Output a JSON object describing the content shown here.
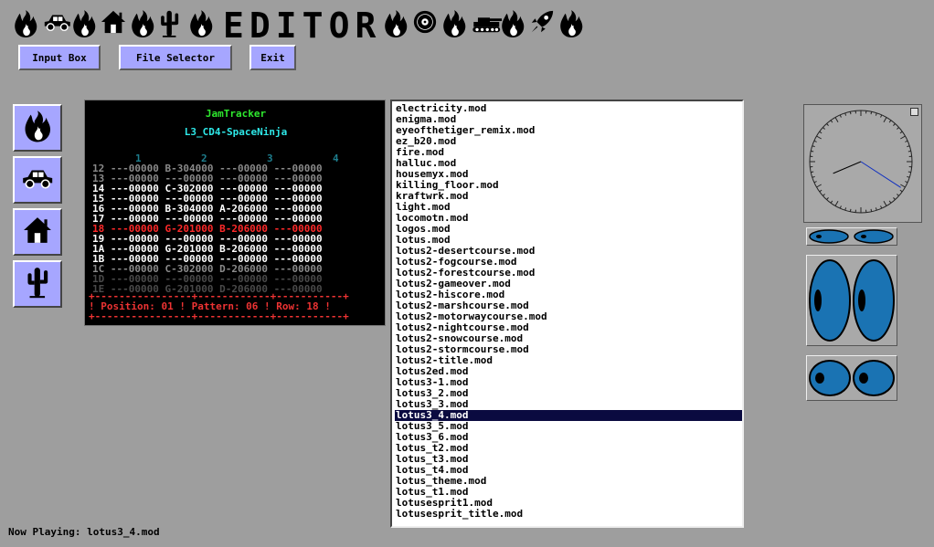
{
  "title": {
    "letters": [
      "E",
      "D",
      "I",
      "T",
      "O",
      "R"
    ]
  },
  "title_icons": {
    "left": [
      "fire-icon",
      "car-icon",
      "fire-icon",
      "house-icon",
      "fire-icon",
      "cactus-icon",
      "fire-icon"
    ],
    "right": [
      "fire-icon",
      "vinyl-record-icon",
      "fire-icon",
      "tank-icon",
      "fire-icon",
      "rocket-icon",
      "fire-icon"
    ]
  },
  "toolbar": {
    "input_box": "Input Box",
    "file_selector": "File Selector",
    "exit": "Exit"
  },
  "side_buttons": [
    "fire-icon",
    "car-icon",
    "house-icon",
    "cactus-icon"
  ],
  "tracker": {
    "app_name": "JamTracker",
    "song_name": "L3_CD4-SpaceNinja",
    "columns": [
      "1",
      "2",
      "3",
      "4"
    ],
    "rows": [
      {
        "text": "12 ---00000 B-304000 ---00000 ---00000",
        "style": "dim"
      },
      {
        "text": "13 ---00000 ---00000 ---00000 ---00000",
        "style": "dim"
      },
      {
        "text": "14 ---00000 C-302000 ---00000 ---00000",
        "style": "normal"
      },
      {
        "text": "15 ---00000 ---00000 ---00000 ---00000",
        "style": "normal"
      },
      {
        "text": "16 ---00000 B-304000 A-206000 ---00000",
        "style": "normal"
      },
      {
        "text": "17 ---00000 ---00000 ---00000 ---00000",
        "style": "normal"
      },
      {
        "text": "18 ---00000 G-201000 B-206000 ---00000",
        "style": "current"
      },
      {
        "text": "19 ---00000 ---00000 ---00000 ---00000",
        "style": "normal"
      },
      {
        "text": "1A ---00000 G-201000 B-206000 ---00000",
        "style": "normal"
      },
      {
        "text": "1B ---00000 ---00000 ---00000 ---00000",
        "style": "normal"
      },
      {
        "text": "1C ---00000 C-302000 D-206000 ---00000",
        "style": "dim"
      },
      {
        "text": "1D ---00000 ---00000 ---00000 ---00000",
        "style": "dimmer"
      },
      {
        "text": "1E ---00000 G-201000 D-206000 ---00000",
        "style": "dimmer"
      }
    ],
    "status_top": "+----------------+------------+-----------+",
    "status": "! Position: 01 ! Pattern: 06 ! Row: 18 !",
    "status_bottom": "+----------------+------------+-----------+",
    "colors": {
      "app_name": "#2ee82e",
      "song_name": "#2ee8e8",
      "current": "#ff2a2a",
      "normal": "#ffffff",
      "dim": "#8a8a8a",
      "dimmer": "#4a4a4a"
    }
  },
  "files": [
    "electricity.mod",
    "enigma.mod",
    "eyeofthetiger_remix.mod",
    "ez_b20.mod",
    "fire.mod",
    "halluc.mod",
    "housemyx.mod",
    "killing_floor.mod",
    "kraftwrk.mod",
    "light.mod",
    "locomotn.mod",
    "logos.mod",
    "lotus.mod",
    "lotus2-desertcourse.mod",
    "lotus2-fogcourse.mod",
    "lotus2-forestcourse.mod",
    "lotus2-gameover.mod",
    "lotus2-hiscore.mod",
    "lotus2-marshcourse.mod",
    "lotus2-motorwaycourse.mod",
    "lotus2-nightcourse.mod",
    "lotus2-snowcourse.mod",
    "lotus2-stormcourse.mod",
    "lotus2-title.mod",
    "lotus2ed.mod",
    "lotus3-1.mod",
    "lotus3_2.mod",
    "lotus3_3.mod",
    "lotus3_4.mod",
    "lotus3_5.mod",
    "lotus3_6.mod",
    "lotus_t2.mod",
    "lotus_t3.mod",
    "lotus_t4.mod",
    "lotus_theme.mod",
    "lotus_t1.mod",
    "lotusesprit1.mod",
    "lotusesprit_title.mod"
  ],
  "selected_file": "lotus3_4.mod",
  "clock": {
    "hour_angle_deg": 247,
    "minute_angle_deg": 123
  },
  "eye_color": "#1a73b3",
  "now_playing": {
    "label": "Now Playing:",
    "value": "lotus3_4.mod"
  }
}
